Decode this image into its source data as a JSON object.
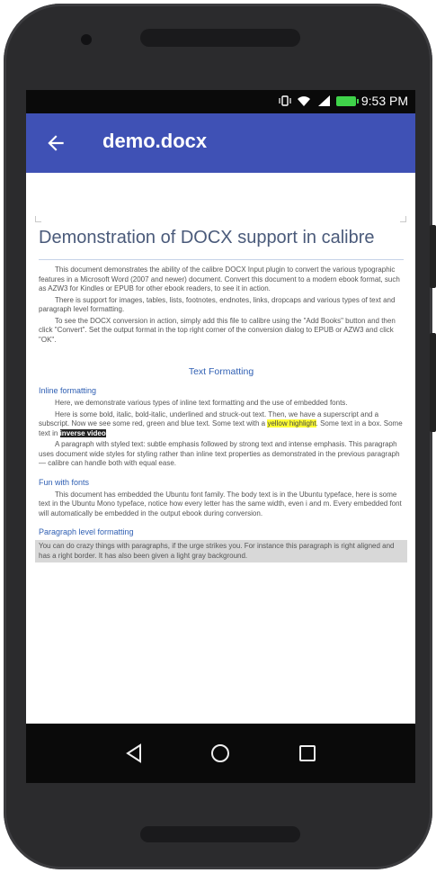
{
  "status": {
    "time": "9:53 PM"
  },
  "appbar": {
    "title": "demo.docx"
  },
  "doc": {
    "title": "Demonstration of DOCX support in calibre",
    "intro": [
      "This document demonstrates the ability of the calibre DOCX Input plugin to convert the various typographic features in a Microsoft Word (2007 and newer) document. Convert this document to a modern ebook format, such as AZW3 for Kindles or EPUB for other ebook readers, to see it in action.",
      "There is support for images, tables, lists, footnotes, endnotes, links, dropcaps and various types of text and paragraph level formatting.",
      "To see the DOCX conversion in action, simply add this file to calibre using the \"Add Books\" button and then click \"Convert\". Set the output format in the top right corner of the conversion dialog to EPUB or AZW3 and click \"OK\"."
    ],
    "section_title": "Text Formatting",
    "inline_heading": "Inline formatting",
    "inline_paras": [
      "Here, we demonstrate various types of inline text formatting and the use of embedded fonts.",
      "Here is some bold, italic, bold-italic, underlined and struck-out text. Then, we have a superscript and a subscript. Now we see some red, green and blue text. Some text with a",
      "yellow highlight",
      ". Some text in a box. Some text in",
      "inverse video",
      "A paragraph with styled text: subtle emphasis followed by strong text and intense emphasis. This paragraph uses document wide styles for styling rather than inline text properties as demonstrated in the previous paragraph — calibre can handle both with equal ease."
    ],
    "fonts_heading": "Fun with fonts",
    "fonts_para": "This document has embedded the Ubuntu font family. The body text is in the Ubuntu typeface, here is some text in the Ubuntu Mono typeface, notice how every letter has the same width, even i and m. Every embedded font will automatically be embedded in the output ebook during conversion.",
    "para_heading": "Paragraph level formatting",
    "para_block": "You can do crazy things with paragraphs, if the urge strikes you. For instance this paragraph is right aligned and has a right border. It has also been given a light gray background."
  },
  "icons": {
    "back": "arrow-back-icon",
    "nav_back": "triangle-back-icon",
    "nav_home": "circle-home-icon",
    "nav_recent": "square-recent-icon",
    "battery": "battery-icon",
    "wifi": "wifi-icon",
    "signal": "signal-icon",
    "vibrate": "vibrate-icon"
  },
  "colors": {
    "appbar": "#3f51b5",
    "heading": "#2f5fb3"
  }
}
